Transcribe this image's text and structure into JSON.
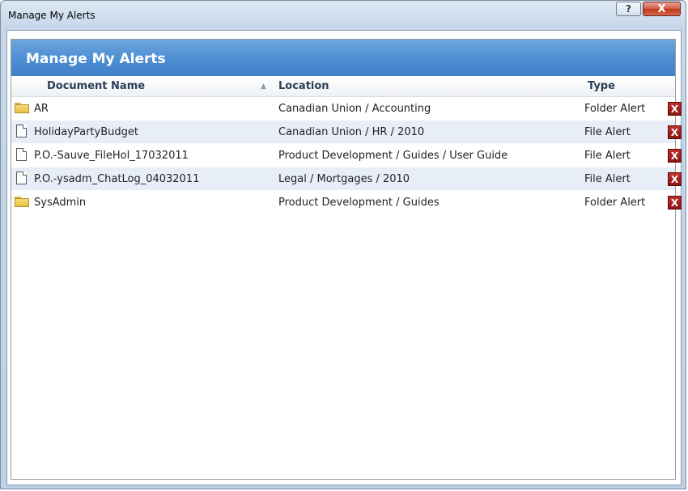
{
  "window": {
    "title": "Manage My Alerts",
    "help_label": "?",
    "close_label": "X"
  },
  "panel": {
    "title": "Manage My Alerts",
    "columns": {
      "name": "Document Name",
      "location": "Location",
      "type": "Type"
    },
    "sort_indicator": "▲",
    "delete_label": "X",
    "rows": [
      {
        "icon": "folder-icon",
        "name": "AR",
        "location": "Canadian Union / Accounting",
        "type": "Folder Alert"
      },
      {
        "icon": "file-icon",
        "name": "HolidayPartyBudget",
        "location": "Canadian Union / HR / 2010",
        "type": "File Alert"
      },
      {
        "icon": "file-icon",
        "name": "P.O.-Sauve_FileHol_17032011",
        "location": "Product Development / Guides / User Guide",
        "type": "File Alert"
      },
      {
        "icon": "file-icon",
        "name": "P.O.-ysadm_ChatLog_04032011",
        "location": "Legal / Mortgages / 2010",
        "type": "File Alert"
      },
      {
        "icon": "folder-icon",
        "name": "SysAdmin",
        "location": "Product Development / Guides",
        "type": "Folder Alert"
      }
    ]
  },
  "colors": {
    "header_blue": "#4f8fd3",
    "alt_row": "#e8eef8",
    "delete_red": "#a8201b"
  }
}
